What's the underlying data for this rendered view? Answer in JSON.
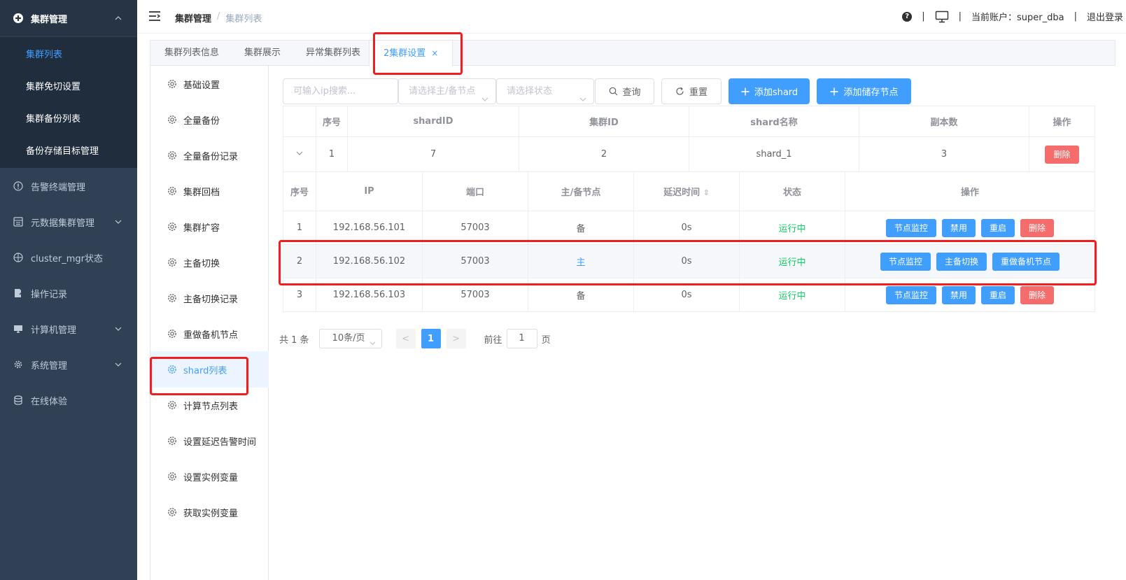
{
  "sidebar": {
    "group_title": "集群管理",
    "sub_items": [
      "集群列表",
      "集群免切设置",
      "集群备份列表",
      "备份存储目标管理"
    ],
    "items": [
      {
        "label": "告警终端管理",
        "icon": "info-circle-icon",
        "arrow": false
      },
      {
        "label": "元数据集群管理",
        "icon": "database-panel-icon",
        "arrow": true
      },
      {
        "label": "cluster_mgr状态",
        "icon": "crosshair-icon",
        "arrow": false
      },
      {
        "label": "操作记录",
        "icon": "edit-doc-icon",
        "arrow": false
      },
      {
        "label": "计算机管理",
        "icon": "monitor-icon",
        "arrow": true
      },
      {
        "label": "系统管理",
        "icon": "gear-icon",
        "arrow": true
      },
      {
        "label": "在线体验",
        "icon": "database-icon",
        "arrow": false
      }
    ]
  },
  "header": {
    "breadcrumb_root": "集群管理",
    "breadcrumb_sep": "/",
    "breadcrumb_current": "集群列表",
    "help_label": "?",
    "sep": "|",
    "account_label": "当前账户：super_dba",
    "logout": "退出登录"
  },
  "tabs": {
    "items": [
      "集群列表信息",
      "集群展示",
      "异常集群列表"
    ],
    "active": "2集群设置",
    "close": "×"
  },
  "settings_menu": [
    "基础设置",
    "全量备份",
    "全量备份记录",
    "集群回档",
    "集群扩容",
    "主备切换",
    "主备切换记录",
    "重做备机节点",
    "shard列表",
    "计算节点列表",
    "设置延迟告警时间",
    "设置实例变量",
    "获取实例变量"
  ],
  "toolbar": {
    "ip_placeholder": "可输入ip搜索...",
    "role_placeholder": "请选择主/备节点",
    "status_placeholder": "请选择状态",
    "query": "查询",
    "reset": "重置",
    "add_shard": "添加shard",
    "add_storage": "添加储存节点"
  },
  "shard_table": {
    "headers": [
      "序号",
      "shardID",
      "集群ID",
      "shard名称",
      "副本数",
      "操作"
    ],
    "row": {
      "expand": "⌄",
      "index": "1",
      "shard_id": "7",
      "cluster_id": "2",
      "name": "shard_1",
      "replicas": "3",
      "delete": "删除"
    }
  },
  "node_table": {
    "headers": [
      "序号",
      "IP",
      "端口",
      "主/备节点",
      "延迟时间",
      "状态",
      "操作"
    ],
    "sort_icon": "⇕",
    "rows": [
      {
        "index": "1",
        "ip": "192.168.56.101",
        "port": "57003",
        "role": "备",
        "delay": "0s",
        "status": "运行中",
        "actions": [
          "节点监控",
          "禁用",
          "重启",
          "删除"
        ]
      },
      {
        "index": "2",
        "ip": "192.168.56.102",
        "port": "57003",
        "role": "主",
        "delay": "0s",
        "status": "运行中",
        "actions": [
          "节点监控",
          "主备切换",
          "重做备机节点"
        ]
      },
      {
        "index": "3",
        "ip": "192.168.56.103",
        "port": "57003",
        "role": "备",
        "delay": "0s",
        "status": "运行中",
        "actions": [
          "节点监控",
          "禁用",
          "重启",
          "删除"
        ]
      }
    ]
  },
  "pagination": {
    "total": "共 1 条",
    "page_size": "10条/页",
    "prev": "<",
    "current": "1",
    "next": ">",
    "goto": "前往",
    "goto_value": "1",
    "page_unit": "页"
  },
  "colors": {
    "primary": "#409eff",
    "danger": "#f56c6c",
    "success": "#13ce66",
    "sidebar": "#304156",
    "annotation": "#f01e1e"
  }
}
